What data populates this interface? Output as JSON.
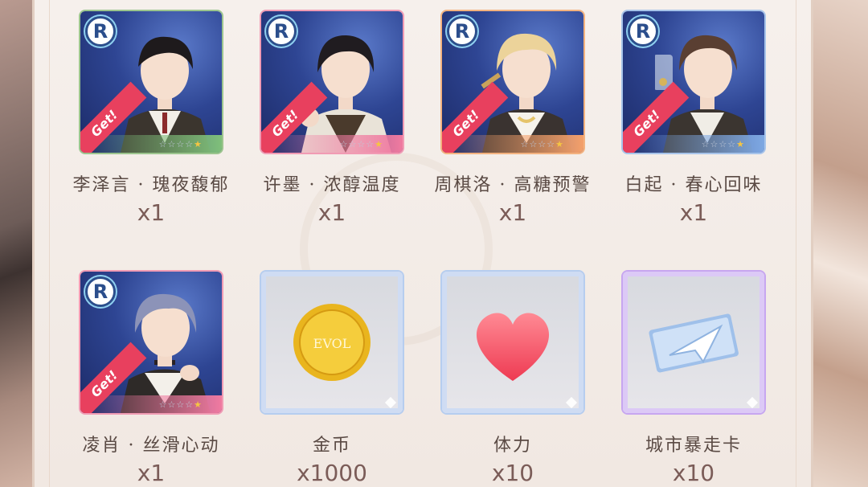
{
  "rewards": [
    {
      "type": "character",
      "badge": "R",
      "tag": "Get!",
      "name": "李泽言 · 瑰夜馥郁",
      "qty": "x1",
      "frame": "#9cc58e",
      "hair": "#1e1a1c",
      "rarity_stars": 5,
      "lit_stars": 1
    },
    {
      "type": "character",
      "badge": "R",
      "tag": "Get!",
      "name": "许墨 · 浓醇温度",
      "qty": "x1",
      "frame": "#f19bb4",
      "hair": "#201c20",
      "rarity_stars": 5,
      "lit_stars": 1
    },
    {
      "type": "character",
      "badge": "R",
      "tag": "Get!",
      "name": "周棋洛 · 高糖预警",
      "qty": "x1",
      "frame": "#f3b27f",
      "hair": "#ecd39a",
      "rarity_stars": 5,
      "lit_stars": 1
    },
    {
      "type": "character",
      "badge": "R",
      "tag": "Get!",
      "name": "白起 · 春心回味",
      "qty": "x1",
      "frame": "#a7c4ea",
      "hair": "#5a3f32",
      "rarity_stars": 5,
      "lit_stars": 1
    },
    {
      "type": "character",
      "badge": "R",
      "tag": "Get!",
      "name": "凌肖 · 丝滑心动",
      "qty": "x1",
      "frame": "#f19bb4",
      "hair": "#8c93b8",
      "rarity_stars": 5,
      "lit_stars": 1
    },
    {
      "type": "item",
      "icon": "gold-coin-icon",
      "icon_text": "EVOL",
      "name": "金币",
      "qty": "x1000"
    },
    {
      "type": "item",
      "icon": "heart-icon",
      "name": "体力",
      "qty": "x10"
    },
    {
      "type": "item",
      "icon": "paper-plane-ticket-icon",
      "name": "城市暴走卡",
      "qty": "x10"
    }
  ],
  "colors": {
    "accent_red": "#e8405e",
    "badge_blue": "#2b4e8c",
    "name_text": "#5a4a44",
    "qty_text": "#7b5c58"
  }
}
